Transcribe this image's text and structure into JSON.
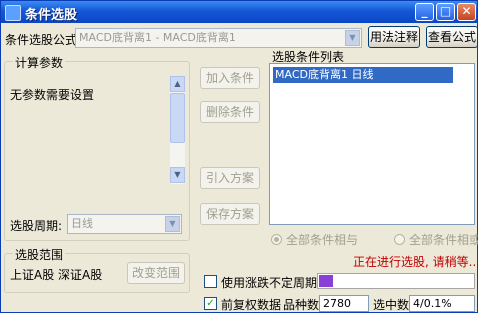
{
  "window": {
    "title": "条件选股",
    "min_label": "_",
    "max_label": "□",
    "close_label": "✕"
  },
  "formula": {
    "label": "条件选股公式",
    "value": "MACD底背离1  - MACD底背离1",
    "usage_button": "用法注释",
    "view_button": "查看公式"
  },
  "params": {
    "group_title": "计算参数",
    "text": "无参数需要设置",
    "period_label": "选股周期:",
    "period_value": "日线"
  },
  "actions": {
    "add": "加入条件",
    "remove": "删除条件",
    "import": "引入方案",
    "save": "保存方案"
  },
  "conditions": {
    "title": "选股条件列表",
    "items": [
      "MACD底背离1  日线"
    ],
    "radio_and": "全部条件相与",
    "radio_or": "全部条件相或"
  },
  "range": {
    "group_title": "选股范围",
    "text": "上证A股 深证A股",
    "change_button": "改变范围"
  },
  "options": {
    "irregular_label": "使用涨跌不定周期",
    "irregular_checked": false,
    "adjusted_label": "前复权数据",
    "adjusted_checked": true
  },
  "status": {
    "message": "正在进行选股, 请稍等...",
    "progress": 0.1
  },
  "stats": {
    "varieties_label": "品种数",
    "varieties_value": "2780",
    "selected_label": "选中数",
    "selected_value": "4/0.1%"
  },
  "colors": {
    "titlebar": "#1557d6",
    "selection": "#316ac5",
    "status_text": "#c00000",
    "progress_fill": "#8a3fd6"
  }
}
